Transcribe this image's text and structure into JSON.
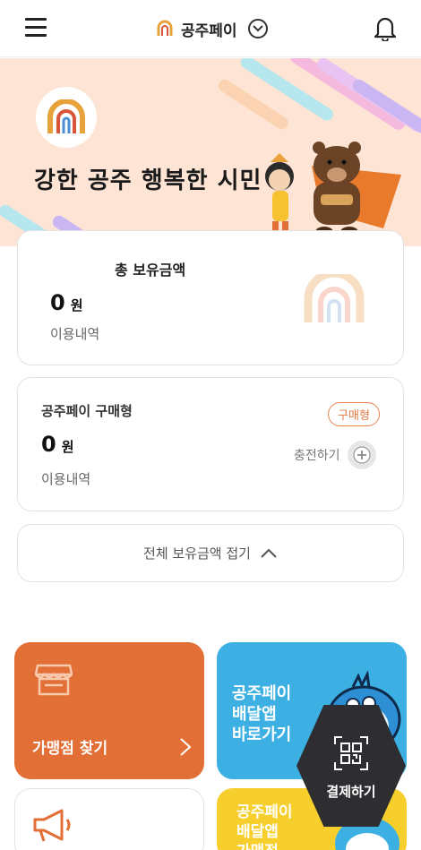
{
  "header": {
    "title": "공주페이",
    "menu_icon": "hamburger-menu-icon",
    "notification_icon": "bell-icon"
  },
  "banner": {
    "slogan": "강한 공주 행복한 시민"
  },
  "total_balance": {
    "label": "총 보유금액",
    "amount": "0",
    "unit": "원",
    "history_label": "이용내역"
  },
  "purchase_wallet": {
    "label": "공주페이 구매형",
    "badge": "구매형",
    "amount": "0",
    "unit": "원",
    "history_label": "이용내역",
    "charge_label": "충전하기"
  },
  "collapse": {
    "label": "전체 보유금액 접기"
  },
  "tiles": {
    "store_finder": "가맹점 찾기",
    "delivery_line1": "공주페이",
    "delivery_line2": "배달앱",
    "delivery_line3": "바로가기",
    "purchase_line1": "공주페이",
    "purchase_line2": "배달앱",
    "purchase_line3": "가맹점"
  },
  "pay_button": {
    "label": "결제하기"
  },
  "colors": {
    "accent_orange": "#e26f35",
    "delivery_blue": "#3db0e3",
    "purchase_yellow": "#f6cf2c",
    "banner_bg": "#fde4d4"
  }
}
